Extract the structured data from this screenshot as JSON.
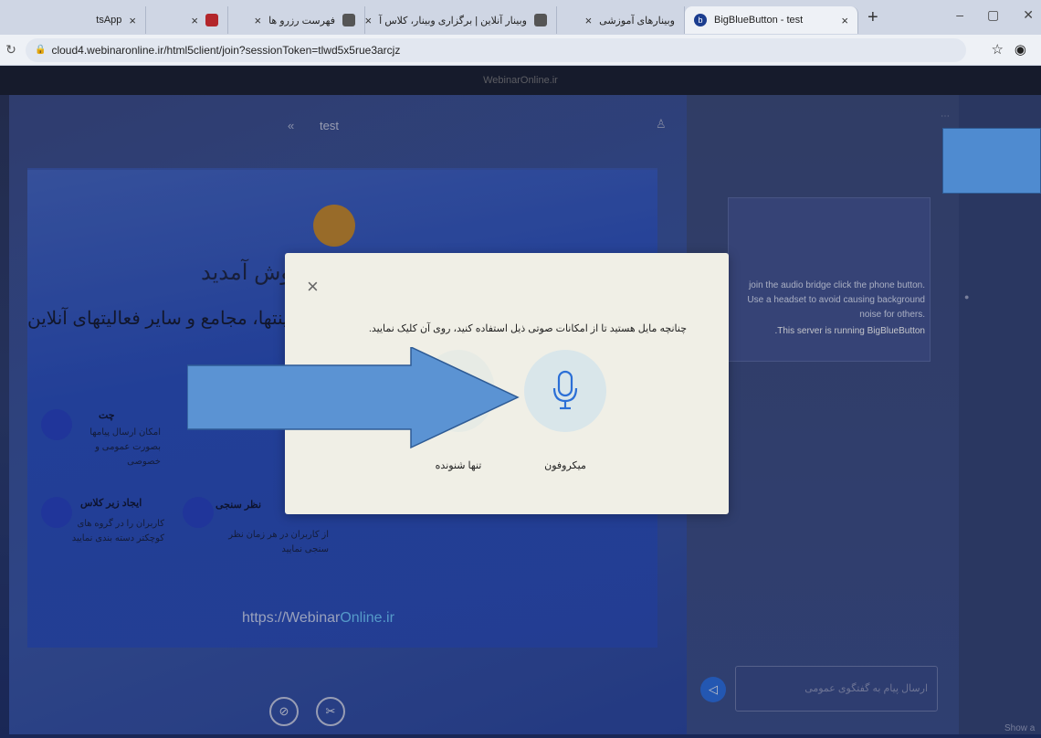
{
  "browser": {
    "tabs": [
      {
        "label": "tsApp",
        "close": "×"
      },
      {
        "label": "",
        "close": "×"
      },
      {
        "label": "فهرست رزرو ها",
        "close": "×"
      },
      {
        "label": "وبینار آنلاین | برگزاری وبینار، کلاس آ",
        "close": "×"
      },
      {
        "label": "وبینارهای آموزشی",
        "close": "×"
      },
      {
        "label": "BigBlueButton - test",
        "close": "×",
        "active": true
      }
    ],
    "new_tab": "+",
    "url": "cloud4.webinaronline.ir/html5client/join?sessionToken=tlwd5x5rue3arcjz"
  },
  "site_header": "WebinarOnline.ir",
  "presentation": {
    "title": "test",
    "slide": {
      "welcome": "وش آمدید",
      "subtitle": "...ینتها، مجامع و سایر فعالیتهای آنلاین",
      "features": [
        {
          "title": "چت",
          "desc": "امکان ارسال پیامها بصورت عمومی و خصوصی"
        },
        {
          "title": "ایجاد زیر کلاس",
          "desc": "کاربران را در گروه های کوچکتر دسته بندی نمایید"
        },
        {
          "title": "نظر سنجی",
          "desc": "از کاربران در هر زمان نظر سنجی نمایید"
        }
      ],
      "url_prefix": "https://Webinar",
      "url_suffix": "Online.ir"
    }
  },
  "chat": {
    "info": "join the audio bridge click the phone button. Use a headset to avoid causing background noise for others.",
    "running": ".This server is running BigBlueButton",
    "input_placeholder": "ارسال پیام به گفتگوی عمومی"
  },
  "footer_label": "Show a",
  "modal": {
    "close": "×",
    "question": "چنانچه مایل هستید تا از امکانات صوتی ذیل استفاده کنید، روی آن کلیک نمایید.",
    "mic_label": "میکروفون",
    "listen_label": "تنها شنونده"
  },
  "colors": {
    "annotation": "#5b93d3",
    "primary": "#2b6fe0"
  }
}
